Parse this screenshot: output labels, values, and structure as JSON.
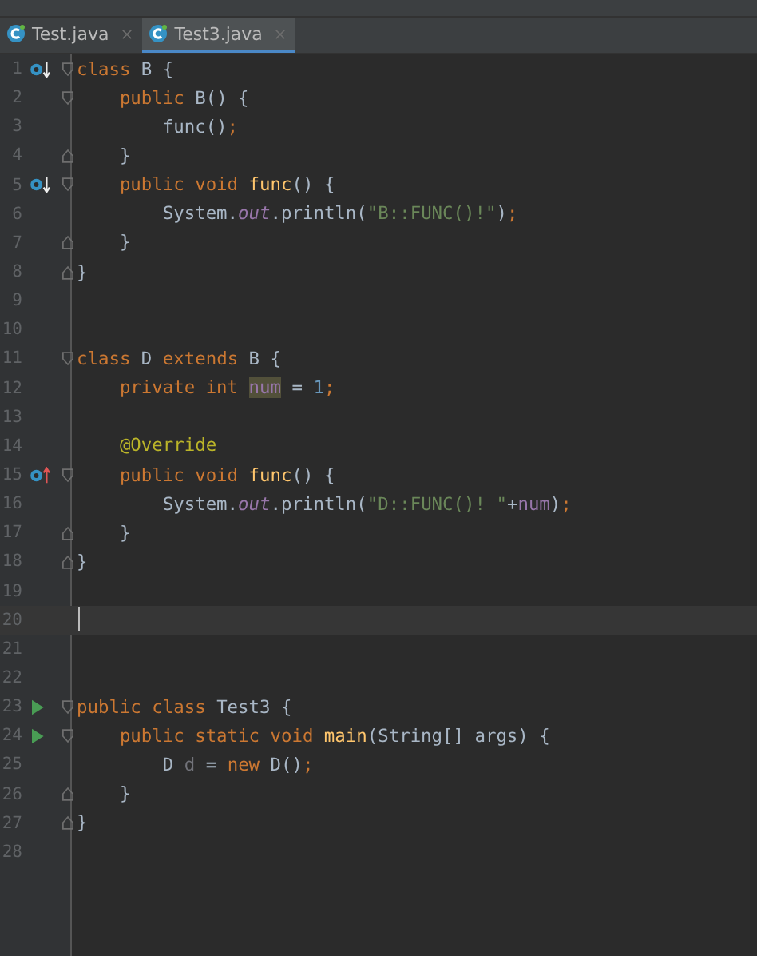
{
  "tabs": [
    {
      "label": "Test.java",
      "selected": false
    },
    {
      "label": "Test3.java",
      "selected": true
    }
  ],
  "lines": [
    {
      "number": "1",
      "current": false,
      "gutter": {
        "kind": "overridden"
      },
      "fold": {
        "kind": "open"
      },
      "tokens": [
        {
          "kind": "keyword",
          "text": "class "
        },
        {
          "kind": "plain",
          "text": "B {"
        }
      ]
    },
    {
      "number": "2",
      "current": false,
      "fold": {
        "kind": "open"
      },
      "tokens": [
        {
          "kind": "keyword",
          "text": "    public "
        },
        {
          "kind": "plain",
          "text": "B() {"
        }
      ]
    },
    {
      "number": "3",
      "current": false,
      "tokens": [
        {
          "kind": "plain",
          "text": "        func()"
        },
        {
          "kind": "keyword",
          "text": ";"
        }
      ]
    },
    {
      "number": "4",
      "current": false,
      "fold": {
        "kind": "close"
      },
      "tokens": [
        {
          "kind": "plain",
          "text": "    }"
        }
      ]
    },
    {
      "number": "5",
      "current": false,
      "gutter": {
        "kind": "overridden"
      },
      "fold": {
        "kind": "open"
      },
      "tokens": [
        {
          "kind": "keyword",
          "text": "    public void "
        },
        {
          "kind": "method",
          "text": "func"
        },
        {
          "kind": "plain",
          "text": "() {"
        }
      ]
    },
    {
      "number": "6",
      "current": false,
      "tokens": [
        {
          "kind": "plain",
          "text": "        System."
        },
        {
          "kind": "field",
          "text": "out"
        },
        {
          "kind": "plain",
          "text": ".println("
        },
        {
          "kind": "string",
          "text": "\"B::FUNC()!\""
        },
        {
          "kind": "plain",
          "text": ")"
        },
        {
          "kind": "keyword",
          "text": ";"
        }
      ]
    },
    {
      "number": "7",
      "current": false,
      "fold": {
        "kind": "close"
      },
      "tokens": [
        {
          "kind": "plain",
          "text": "    }"
        }
      ]
    },
    {
      "number": "8",
      "current": false,
      "fold": {
        "kind": "close"
      },
      "tokens": [
        {
          "kind": "plain",
          "text": "}"
        }
      ]
    },
    {
      "number": "9",
      "current": false
    },
    {
      "number": "10",
      "current": false
    },
    {
      "number": "11",
      "current": false,
      "fold": {
        "kind": "open"
      },
      "tokens": [
        {
          "kind": "keyword",
          "text": "class "
        },
        {
          "kind": "plain",
          "text": "D "
        },
        {
          "kind": "keyword",
          "text": "extends "
        },
        {
          "kind": "plain",
          "text": "B {"
        }
      ]
    },
    {
      "number": "12",
      "current": false,
      "tokens": [
        {
          "kind": "keyword",
          "text": "    private int "
        },
        {
          "kind": "highlight",
          "text": "num"
        },
        {
          "kind": "plain",
          "text": " = "
        },
        {
          "kind": "number",
          "text": "1"
        },
        {
          "kind": "keyword",
          "text": ";"
        }
      ]
    },
    {
      "number": "13",
      "current": false
    },
    {
      "number": "14",
      "current": false,
      "tokens": [
        {
          "kind": "annotation",
          "text": "    @Override"
        }
      ]
    },
    {
      "number": "15",
      "current": false,
      "gutter": {
        "kind": "overrides"
      },
      "fold": {
        "kind": "open"
      },
      "tokens": [
        {
          "kind": "keyword",
          "text": "    public void "
        },
        {
          "kind": "method",
          "text": "func"
        },
        {
          "kind": "plain",
          "text": "() {"
        }
      ]
    },
    {
      "number": "16",
      "current": false,
      "tokens": [
        {
          "kind": "plain",
          "text": "        System."
        },
        {
          "kind": "field",
          "text": "out"
        },
        {
          "kind": "plain",
          "text": ".println("
        },
        {
          "kind": "string",
          "text": "\"D::FUNC()! \""
        },
        {
          "kind": "plain",
          "text": "+"
        },
        {
          "kind": "member",
          "text": "num"
        },
        {
          "kind": "plain",
          "text": ")"
        },
        {
          "kind": "keyword",
          "text": ";"
        }
      ]
    },
    {
      "number": "17",
      "current": false,
      "fold": {
        "kind": "close"
      },
      "tokens": [
        {
          "kind": "plain",
          "text": "    }"
        }
      ]
    },
    {
      "number": "18",
      "current": false,
      "fold": {
        "kind": "close"
      },
      "tokens": [
        {
          "kind": "plain",
          "text": "}"
        }
      ]
    },
    {
      "number": "19",
      "current": false
    },
    {
      "number": "20",
      "current": true
    },
    {
      "number": "21",
      "current": false
    },
    {
      "number": "22",
      "current": false
    },
    {
      "number": "23",
      "current": false,
      "gutter": {
        "kind": "run"
      },
      "fold": {
        "kind": "open"
      },
      "tokens": [
        {
          "kind": "keyword",
          "text": "public class "
        },
        {
          "kind": "plain",
          "text": "Test3 {"
        }
      ]
    },
    {
      "number": "24",
      "current": false,
      "gutter": {
        "kind": "run"
      },
      "fold": {
        "kind": "open"
      },
      "tokens": [
        {
          "kind": "keyword",
          "text": "    public static void "
        },
        {
          "kind": "method",
          "text": "main"
        },
        {
          "kind": "plain",
          "text": "(String[] args) {"
        }
      ]
    },
    {
      "number": "25",
      "current": false,
      "tokens": [
        {
          "kind": "plain",
          "text": "        D "
        },
        {
          "kind": "unused",
          "text": "d"
        },
        {
          "kind": "plain",
          "text": " = "
        },
        {
          "kind": "keyword",
          "text": "new "
        },
        {
          "kind": "plain",
          "text": "D()"
        },
        {
          "kind": "keyword",
          "text": ";"
        }
      ]
    },
    {
      "number": "26",
      "current": false,
      "fold": {
        "kind": "close"
      },
      "tokens": [
        {
          "kind": "plain",
          "text": "    }"
        }
      ]
    },
    {
      "number": "27",
      "current": false,
      "fold": {
        "kind": "close"
      },
      "tokens": [
        {
          "kind": "plain",
          "text": "}"
        }
      ]
    },
    {
      "number": "28",
      "current": false
    }
  ]
}
